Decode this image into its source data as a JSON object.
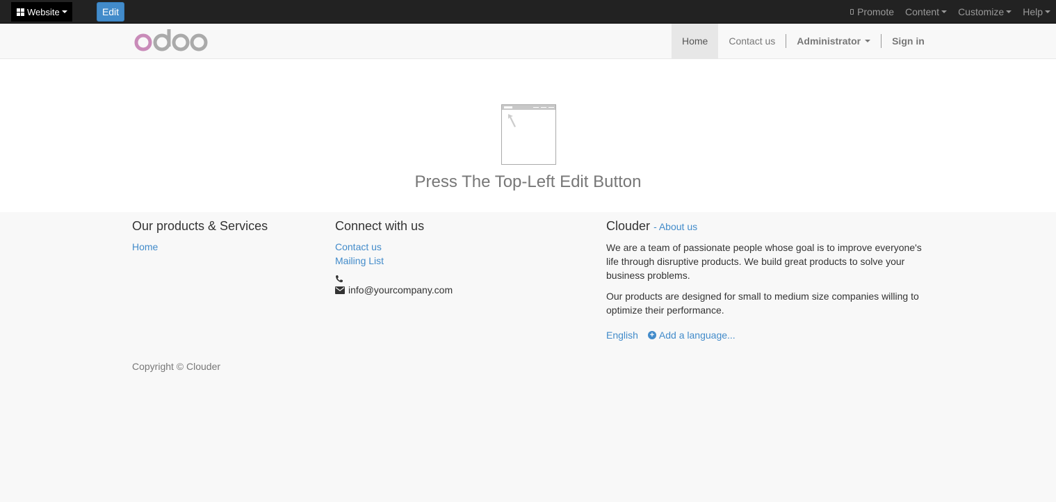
{
  "adminbar": {
    "website_label": "Website",
    "edit_label": "Edit",
    "right_items": [
      "Promote",
      "Content",
      "Customize",
      "Help"
    ]
  },
  "navbar": {
    "logo_text": "odoo",
    "items": [
      "Home",
      "Contact us",
      "Administrator",
      "Sign in"
    ]
  },
  "main": {
    "hint": "Press The Top-Left Edit Button"
  },
  "footer": {
    "products": {
      "title": "Our products & Services",
      "links": [
        "Home"
      ]
    },
    "connect": {
      "title": "Connect with us",
      "links": [
        "Contact us",
        "Mailing List"
      ],
      "phone": "",
      "email": "info@yourcompany.com"
    },
    "about": {
      "title": "Clouder",
      "link": "- About us",
      "p1": "We are a team of passionate people whose goal is to improve everyone's life through disruptive products. We build great products to solve your business problems.",
      "p2": "Our products are designed for small to medium size companies willing to optimize their performance.",
      "lang": "English",
      "add_lang": "Add a language..."
    },
    "copyright": "Copyright © Clouder"
  },
  "colors": {
    "link": "#428bca",
    "edit_btn": "#428bca",
    "adminbar": "#222222",
    "logo_o": "#c98bb9",
    "logo_doo": "#aaaaaa"
  }
}
